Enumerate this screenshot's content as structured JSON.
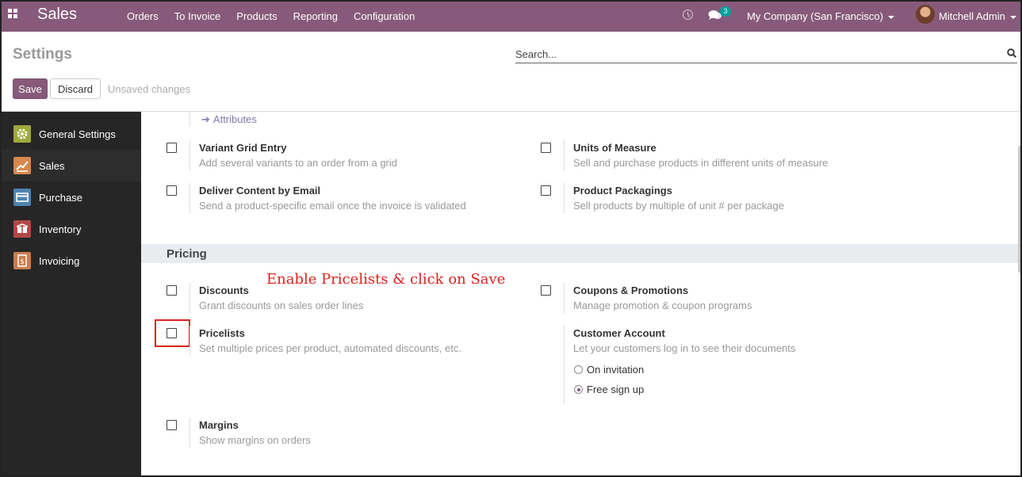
{
  "navbar": {
    "app_name": "Sales",
    "menu": [
      "Orders",
      "To Invoice",
      "Products",
      "Reporting",
      "Configuration"
    ],
    "chat_badge": "3",
    "company": "My Company (San Francisco)",
    "user": "Mitchell Admin"
  },
  "control_panel": {
    "title": "Settings",
    "search_placeholder": "Search...",
    "save_label": "Save",
    "discard_label": "Discard",
    "status": "Unsaved changes"
  },
  "sidebar": {
    "items": [
      {
        "label": "General Settings",
        "icon": "gear-icon",
        "color": "#9ea93c"
      },
      {
        "label": "Sales",
        "icon": "chart-icon",
        "color": "#d8884e"
      },
      {
        "label": "Purchase",
        "icon": "card-icon",
        "color": "#4c83b1"
      },
      {
        "label": "Inventory",
        "icon": "box-icon",
        "color": "#b34848"
      },
      {
        "label": "Invoicing",
        "icon": "dollar-doc-icon",
        "color": "#cb7c4c"
      }
    ]
  },
  "content": {
    "attributes_link": "Attributes",
    "options_top": [
      {
        "title": "Variant Grid Entry",
        "desc": "Add several variants to an order from a grid"
      },
      {
        "title": "Units of Measure",
        "desc": "Sell and purchase products in different units of measure"
      },
      {
        "title": "Deliver Content by Email",
        "desc": "Send a product-specific email once the invoice is validated"
      },
      {
        "title": "Product Packagings",
        "desc": "Sell products by multiple of unit # per package"
      }
    ],
    "pricing_section": "Pricing",
    "annotation": "Enable Pricelists & click on Save",
    "pricing_options": [
      {
        "title": "Discounts",
        "desc": "Grant discounts on sales order lines"
      },
      {
        "title": "Coupons & Promotions",
        "desc": "Manage promotion & coupon programs"
      },
      {
        "title": "Pricelists",
        "desc": "Set multiple prices per product, automated discounts, etc."
      },
      {
        "title": "Customer Account",
        "desc": "Let your customers log in to see their documents"
      },
      {
        "title": "Margins",
        "desc": "Show margins on orders"
      }
    ],
    "customer_account_choices": [
      {
        "label": "On invitation",
        "checked": false
      },
      {
        "label": "Free sign up",
        "checked": true
      }
    ]
  },
  "colors": {
    "brand": "#875a7b",
    "annotation": "#d9231f"
  }
}
